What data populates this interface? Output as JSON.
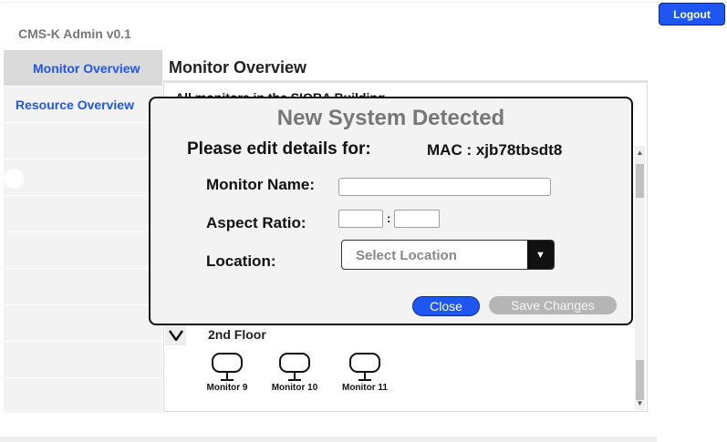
{
  "app": {
    "title": "CMS-K Admin v0.1"
  },
  "header": {
    "logout_label": "Logout"
  },
  "sidebar": {
    "items": [
      {
        "label": "Monitor Overview"
      },
      {
        "label": "Resource Overview"
      }
    ]
  },
  "main": {
    "title": "Monitor Overview",
    "building_heading": "All monitors in the SIORA Building",
    "floor": {
      "label": "2nd Floor",
      "monitors": [
        {
          "name": "Monitor 9"
        },
        {
          "name": "Monitor 10"
        },
        {
          "name": "Monitor 11"
        }
      ]
    }
  },
  "modal": {
    "title": "New System Detected",
    "subtitle": "Please edit details for:",
    "mac": "MAC : xjb78tbsdt8",
    "fields": {
      "name_label": "Monitor Name:",
      "name_value": "",
      "aspect_label": "Aspect Ratio:",
      "aspect_separator": ":",
      "aspect_w_value": "",
      "aspect_h_value": "",
      "location_label": "Location:",
      "location_placeholder": "Select Location"
    },
    "close_label": "Close",
    "save_label": "Save Changes"
  },
  "colors": {
    "accent": "#1d56f0",
    "disabled": "#b5b5b5",
    "muted_text": "#777777"
  }
}
